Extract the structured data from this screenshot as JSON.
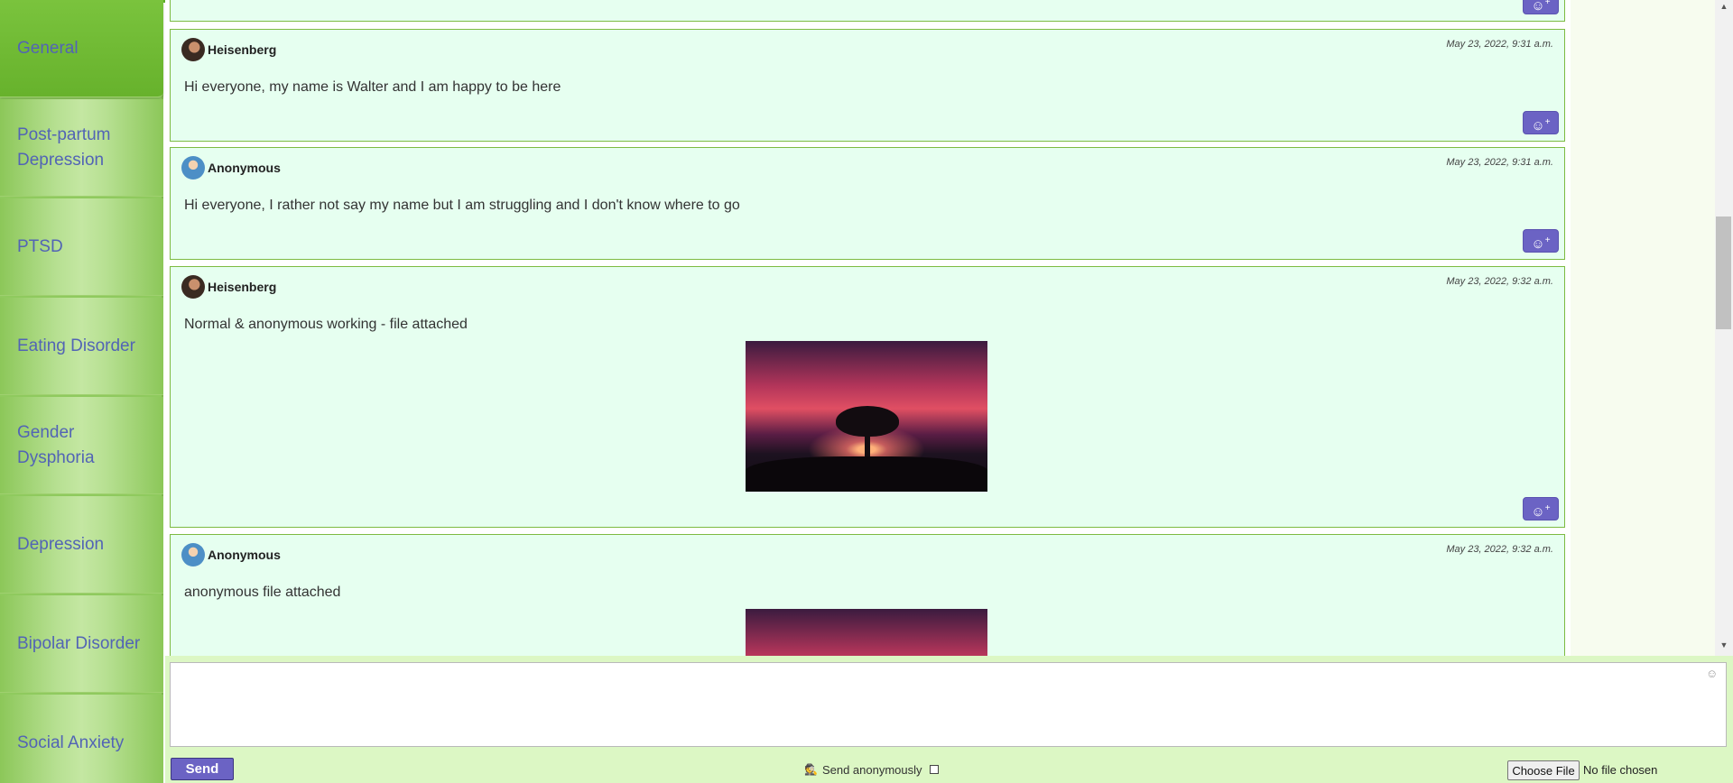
{
  "sidebar": {
    "items": [
      {
        "label": "General",
        "active": true
      },
      {
        "label": "Post-partum Depression"
      },
      {
        "label": "PTSD"
      },
      {
        "label": "Eating Disorder"
      },
      {
        "label": "Gender Dysphoria"
      },
      {
        "label": "Depression"
      },
      {
        "label": "Bipolar Disorder"
      },
      {
        "label": "Social Anxiety"
      }
    ]
  },
  "messages": [
    {
      "author": "Heisenberg",
      "timestamp": "May 23, 2022, 9:31 a.m.",
      "text": "Hi everyone, my name is Walter and I am happy to be here",
      "avatar": "heisenberg-avatar"
    },
    {
      "author": "Anonymous",
      "timestamp": "May 23, 2022, 9:31 a.m.",
      "text": "Hi everyone, I rather not say my name but I am struggling and I don't know where to go",
      "avatar": "anonymous-avatar"
    },
    {
      "author": "Heisenberg",
      "timestamp": "May 23, 2022, 9:32 a.m.",
      "text": "Normal & anonymous working - file attached",
      "avatar": "heisenberg-avatar",
      "attachment": "sunset-tree-image"
    },
    {
      "author": "Anonymous",
      "timestamp": "May 23, 2022, 9:32 a.m.",
      "text": "anonymous file attached",
      "avatar": "anonymous-avatar",
      "attachment": "sunset-tree-image"
    }
  ],
  "composer": {
    "send_label": "Send",
    "anonymous_label": "Send anonymously",
    "file_button_label": "Choose File",
    "file_status": "No file chosen",
    "message_value": ""
  },
  "colors": {
    "sidebar_bg": "#8fca5e",
    "message_bg": "#e6fff0",
    "accent": "#6b63c4",
    "link_text": "#5264b5"
  },
  "icons": {
    "react": "add-reaction-icon",
    "emoji": "emoji-icon",
    "anonymous": "spy-icon"
  }
}
